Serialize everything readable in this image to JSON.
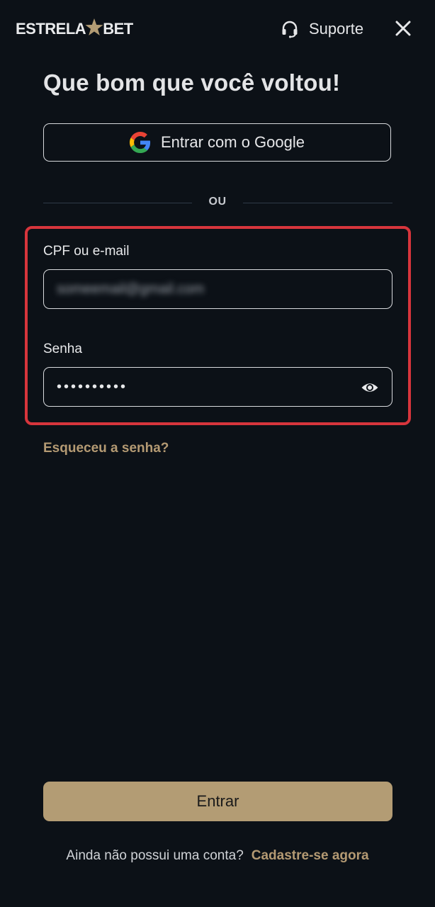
{
  "header": {
    "logo_left": "ESTRELA",
    "logo_right": "BET",
    "support_label": "Suporte",
    "icons": {
      "logo_star": "star-icon",
      "support": "headset-icon",
      "close": "close-icon"
    }
  },
  "title": "Que bom que você voltou!",
  "google_button": {
    "label": "Entrar com o Google",
    "icon": "google-icon"
  },
  "divider_text": "OU",
  "form": {
    "email": {
      "label": "CPF ou e-mail",
      "value": "someemail@gmail.com",
      "blurred": true
    },
    "password": {
      "label": "Senha",
      "value": "••••••••••",
      "toggle_icon": "eye-icon"
    }
  },
  "forgot_password": "Esqueceu a senha?",
  "submit_label": "Entrar",
  "signup": {
    "prompt": "Ainda não possui uma conta?",
    "link": "Cadastre-se agora"
  },
  "colors": {
    "background": "#0c1117",
    "accent": "#b39c74",
    "link": "#b49a73",
    "highlight": "#d7353c",
    "divider": "#2f3a48"
  }
}
